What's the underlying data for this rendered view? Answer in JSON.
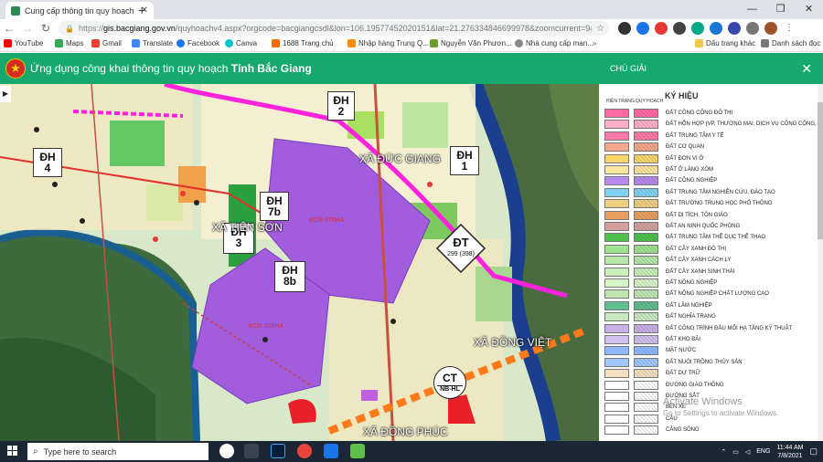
{
  "browser": {
    "tab_title": "Cung cấp thông tin quy hoạch V",
    "url_prefix": "https://",
    "url_host": "gis.bacgiang.gov.vn",
    "url_rest": "/quyhoachv4.aspx?orgcode=bacgiangcsdl&lon=106.19577452020151&lat=21.276334846699978&zoomcurrent=9&gidzl...",
    "bookmarks": [
      "YouTube",
      "Maps",
      "Gmail",
      "Translate",
      "Facebook",
      "Canva",
      "1688 Trang chủ",
      "Nhập hàng Trung Q...",
      "Nguyễn Văn Phươn...",
      "Nhà cung cấp man...",
      "Dấu trang khác",
      "Danh sách đọc"
    ]
  },
  "app": {
    "title_prefix": "Ứng dụng công khai thông tin quy hoạch",
    "title_province": "Tỉnh Bắc Giang"
  },
  "map": {
    "zones": [
      {
        "code": "ĐH",
        "num": "2"
      },
      {
        "code": "ĐH",
        "num": "4"
      },
      {
        "code": "ĐH",
        "num": "1"
      },
      {
        "code": "ĐH",
        "num": "7b"
      },
      {
        "code": "ĐH",
        "num": "3"
      },
      {
        "code": "ĐH",
        "num": "8b"
      }
    ],
    "dt_label": {
      "code": "ĐT",
      "num": "299 (398)"
    },
    "ct_label": {
      "code": "CT",
      "num": "NB-HL"
    },
    "places": [
      "XÃ ĐỨC GIANG",
      "XÃ TIÊN SƠN",
      "XÃ ĐỒNG VIỆT",
      "XÃ ĐỒNG PHÚC"
    ],
    "kcn": [
      "KCN 370HA",
      "KCN 500HA"
    ]
  },
  "legend": {
    "header": "CHÚ GIẢI",
    "heading": "KÝ HIỆU",
    "col_current": "HIỆN TRẠNG",
    "col_plan": "QUY HOẠCH",
    "items": [
      {
        "label": "ĐẤT CÔNG CỘNG ĐÔ THỊ",
        "color": "#ff6ca5"
      },
      {
        "label": "ĐẤT HỖN HỢP (VP, THƯƠNG MẠI, DỊCH VỤ CÔNG CỘNG, Ở)",
        "color": "#ffb0c8"
      },
      {
        "label": "ĐẤT TRUNG TÂM Y TẾ",
        "color": "#ff7aa8"
      },
      {
        "label": "ĐẤT CƠ QUAN",
        "color": "#f5a88a"
      },
      {
        "label": "ĐẤT ĐƠN VỊ Ở",
        "color": "#f7d76a"
      },
      {
        "label": "ĐẤT Ở LÀNG XÓM",
        "color": "#fbe7a0"
      },
      {
        "label": "ĐẤT CÔNG NGHIỆP",
        "color": "#b88af0"
      },
      {
        "label": "ĐẤT TRUNG TÂM NGHIÊN CỨU, ĐÀO TẠO",
        "color": "#7fd3f0"
      },
      {
        "label": "ĐẤT TRƯỜNG TRUNG HỌC PHỔ THÔNG",
        "color": "#f0d080"
      },
      {
        "label": "ĐẤT DI TÍCH, TÔN GIÁO",
        "color": "#e8a060"
      },
      {
        "label": "ĐẤT AN NINH QUỐC PHÒNG",
        "color": "#d6a0a0"
      },
      {
        "label": "ĐẤT TRUNG TÂM THỂ DỤC THỂ THAO",
        "color": "#4cc24c"
      },
      {
        "label": "ĐẤT CÂY XANH ĐÔ THỊ",
        "color": "#9fe38f"
      },
      {
        "label": "ĐẤT CÂY XANH CÁCH LY",
        "color": "#b5e8a8"
      },
      {
        "label": "ĐẤT CÂY XANH SINH THÁI",
        "color": "#c8f0b8"
      },
      {
        "label": "ĐẤT NÔNG NGHIỆP",
        "color": "#d8f5c8"
      },
      {
        "label": "ĐẤT NÔNG NGHIỆP CHẤT LƯỢNG CAO",
        "color": "#bfe6b0"
      },
      {
        "label": "ĐẤT LÂM NGHIỆP",
        "color": "#5fbf8f"
      },
      {
        "label": "ĐẤT NGHĨA TRANG",
        "color": "#c8e8c0"
      },
      {
        "label": "ĐẤT CÔNG TRÌNH ĐẦU MỐI HẠ TẦNG KỸ THUẬT",
        "color": "#c8b0e8"
      },
      {
        "label": "ĐẤT KHO BÃI",
        "color": "#d0c0f0"
      },
      {
        "label": "MẶT NƯỚC",
        "color": "#8fb8ff"
      },
      {
        "label": "ĐẤT NUÔI TRỒNG THỦY SẢN",
        "color": "#a0c8ff"
      },
      {
        "label": "ĐẤT DỰ TRỮ",
        "color": "#f4e0c0"
      },
      {
        "label": "ĐƯỜNG GIAO THÔNG",
        "color": "#ffffff"
      },
      {
        "label": "ĐƯỜNG SẮT",
        "color": "#ffffff"
      },
      {
        "label": "BẾN XE",
        "color": "#ffffff"
      },
      {
        "label": "CẦU",
        "color": "#ffffff"
      },
      {
        "label": "CẢNG SÔNG",
        "color": "#ffffff"
      }
    ],
    "watermark_title": "Activate Windows",
    "watermark_sub": "Go to Settings to activate Windows."
  },
  "taskbar": {
    "search_placeholder": "Type here to search",
    "lang": "ENG",
    "time": "11:44 AM",
    "date": "7/8/2021"
  }
}
